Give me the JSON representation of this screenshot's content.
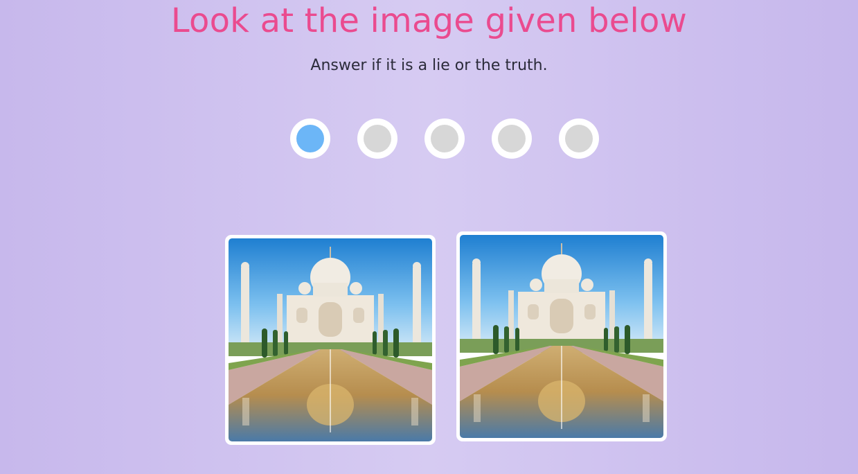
{
  "header": {
    "title": "Look at the image given below",
    "subtitle": "Answer if it is a lie or the truth."
  },
  "progress": {
    "total_steps": 5,
    "current_step": 1,
    "colors": {
      "active": "#6cb6f7",
      "inactive": "#d7d7d7",
      "ring": "#ffffff"
    }
  },
  "images": [
    {
      "name": "taj-mahal-photo-left",
      "icon": "taj-mahal-image"
    },
    {
      "name": "taj-mahal-photo-right",
      "icon": "taj-mahal-image"
    }
  ],
  "theme": {
    "title_color": "#ea4b8f",
    "background": "#d0c4f0"
  }
}
